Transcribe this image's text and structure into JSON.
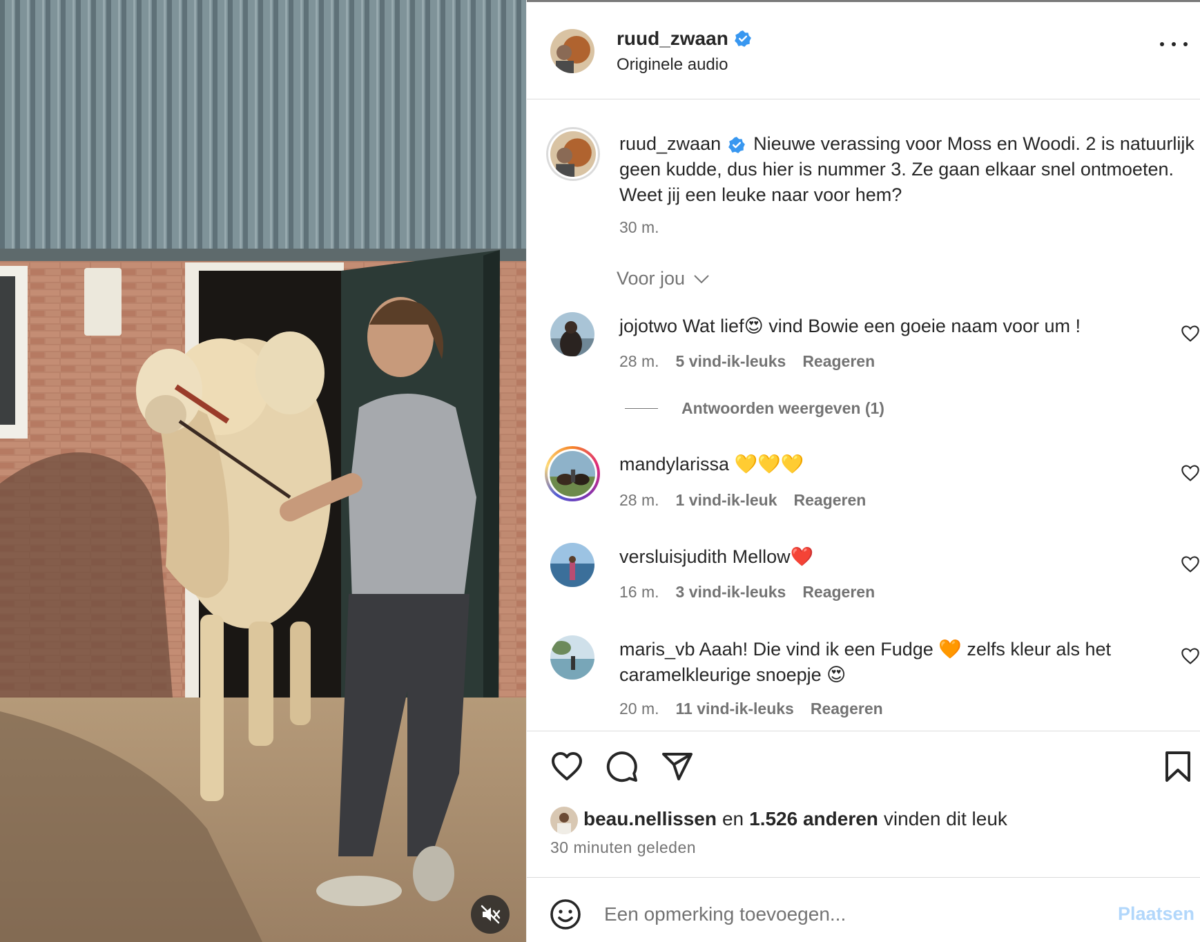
{
  "post": {
    "username": "ruud_zwaan",
    "audio": "Originele audio",
    "caption": "Nieuwe verassing voor Moss en Woodi. 2 is natuurlijk geen kudde, dus hier is nummer 3. Ze gaan elkaar snel ontmoeten. Weet jij een leuke naar voor hem?",
    "time": "30 m."
  },
  "filter": {
    "label": "Voor jou"
  },
  "comments": [
    {
      "user": "jojotwo",
      "text": "Wat lief😍 vind Bowie een goeie naam voor um !",
      "time": "28 m.",
      "likes": "5 vind-ik-leuks",
      "reply": "Reageren",
      "view_replies": "Antwoorden weergeven (1)"
    },
    {
      "user": "mandylarissa",
      "text": "💛💛💛",
      "time": "28 m.",
      "likes": "1 vind-ik-leuk",
      "reply": "Reageren"
    },
    {
      "user": "versluisjudith",
      "text": "Mellow❤️",
      "time": "16 m.",
      "likes": "3 vind-ik-leuks",
      "reply": "Reageren"
    },
    {
      "user": "maris_vb",
      "text": "Aaah! Die vind ik een Fudge 🧡 zelfs kleur als het caramelkleurige snoepje 😍",
      "time": "20 m.",
      "likes": "11 vind-ik-leuks",
      "reply": "Reageren"
    }
  ],
  "likes_summary": {
    "user": "beau.nellissen",
    "connector": "en",
    "others": "1.526 anderen",
    "suffix": "vinden dit leuk"
  },
  "posted_ago": "30 minuten geleden",
  "composer": {
    "placeholder": "Een opmerking toevoegen...",
    "post_label": "Plaatsen"
  },
  "icons": [
    "more-icon",
    "verified-icon",
    "chevron-down-icon",
    "heart-icon",
    "comment-icon",
    "share-icon",
    "bookmark-icon",
    "emoji-icon",
    "mute-icon"
  ],
  "colors": {
    "link_disabled": "#b2d7fb",
    "verified": "#3897f0",
    "secondary_text": "#737373"
  }
}
